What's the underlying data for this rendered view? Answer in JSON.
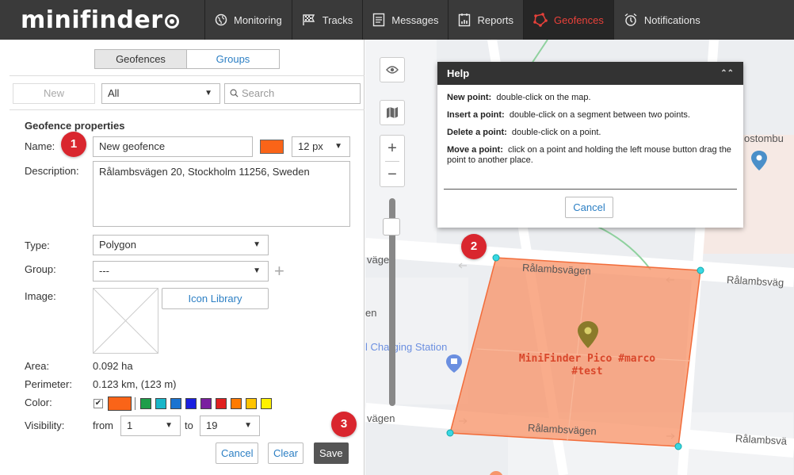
{
  "brand": {
    "logo_text": "minifinder"
  },
  "nav": [
    {
      "label": "Monitoring",
      "icon": "globe-icon",
      "active": false
    },
    {
      "label": "Tracks",
      "icon": "flag-icon",
      "active": false
    },
    {
      "label": "Messages",
      "icon": "message-icon",
      "active": false
    },
    {
      "label": "Reports",
      "icon": "report-icon",
      "active": false
    },
    {
      "label": "Geofences",
      "icon": "geofence-icon",
      "active": true
    },
    {
      "label": "Notifications",
      "icon": "alarm-icon",
      "active": false
    }
  ],
  "panel": {
    "tabs": {
      "geofences": "Geofences",
      "groups": "Groups"
    },
    "toolbar": {
      "new_label": "New",
      "filter_value": "All",
      "search_placeholder": "Search"
    },
    "section_title": "Geofence properties",
    "labels": {
      "name": "Name:",
      "description": "Description:",
      "type": "Type:",
      "group": "Group:",
      "image": "Image:",
      "area": "Area:",
      "perimeter": "Perimeter:",
      "color": "Color:",
      "visibility": "Visibility:",
      "from": "from",
      "to": "to"
    },
    "name_value": "New geofence",
    "font_size": "12 px",
    "description_value": "Rålambsvägen 20, Stockholm 11256, Sweden",
    "type_value": "Polygon",
    "group_value": "---",
    "icon_library_label": "Icon Library",
    "area_value": "0.092 ha",
    "perimeter_value": "0.123 km, (123 m)",
    "color_checked": true,
    "selected_color": "#fa6418",
    "palette": [
      "#1e9e4a",
      "#19b6c9",
      "#1b73d1",
      "#1a1fe0",
      "#7a1fa0",
      "#e0201f",
      "#ff7a00",
      "#ffc400",
      "#fff200"
    ],
    "visibility_from": "1",
    "visibility_to": "19",
    "actions": {
      "cancel": "Cancel",
      "clear": "Clear",
      "save": "Save"
    }
  },
  "badges": {
    "one": "1",
    "two": "2",
    "three": "3"
  },
  "help": {
    "title": "Help",
    "items": [
      {
        "term": "New point:",
        "text": "double-click on the map."
      },
      {
        "term": "Insert a point:",
        "text": "double-click on a segment between two points."
      },
      {
        "term": "Delete a point:",
        "text": "double-click on a point."
      },
      {
        "term": "Move a point:",
        "text": "click on a point and holding the left mouse button drag the point to another place."
      }
    ],
    "cancel_label": "Cancel"
  },
  "map": {
    "street_labels": {
      "top_left": "vägen",
      "top_center": "Rålambsvägen",
      "top_right": "Rålambsväg",
      "bottom_left": "vägen",
      "bottom_center": "Rålambsvägen",
      "bottom_right": "Rålambsvä",
      "left_fragment": "en",
      "charging": "l Charging Station",
      "postombud": "ostombu"
    },
    "geofence_label_line1": "MiniFinder Pico #marco",
    "geofence_label_line2": "#test",
    "polygon_fill": "#f7956a",
    "polygon_stroke": "#f26c3a",
    "vertex_color": "#39d7e3"
  }
}
